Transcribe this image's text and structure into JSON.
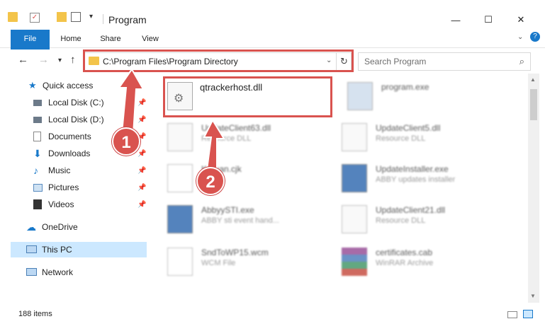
{
  "window": {
    "title": "Program",
    "minimize": "—",
    "maximize": "☐",
    "close": "✕"
  },
  "ribbon": {
    "tabs": [
      "File",
      "Home",
      "Share",
      "View"
    ]
  },
  "address": {
    "path": "C:\\Program Files\\Program Directory"
  },
  "search": {
    "placeholder": "Search Program"
  },
  "sidebar": {
    "items": [
      {
        "label": "Quick access"
      },
      {
        "label": "Local Disk (C:)"
      },
      {
        "label": "Local Disk (D:)"
      },
      {
        "label": "Documents"
      },
      {
        "label": "Downloads"
      },
      {
        "label": "Music"
      },
      {
        "label": "Pictures"
      },
      {
        "label": "Videos"
      },
      {
        "label": "OneDrive"
      },
      {
        "label": "This PC"
      },
      {
        "label": "Network"
      }
    ]
  },
  "files": [
    {
      "name": "qtrackerhost.dll",
      "desc": ""
    },
    {
      "name": "program.exe",
      "desc": ""
    },
    {
      "name": "UpdateClient63.dll",
      "desc": "Resource DLL"
    },
    {
      "name": "UpdateClient5.dll",
      "desc": "Resource DLL"
    },
    {
      "name": "Korean.cjk",
      "desc": ""
    },
    {
      "name": "UpdateInstaller.exe",
      "desc": "ABBY updates installer"
    },
    {
      "name": "AbbyySTI.exe",
      "desc": "ABBY sti event hand..."
    },
    {
      "name": "UpdateClient21.dll",
      "desc": "Resource DLL"
    },
    {
      "name": "SndToWP15.wcm",
      "desc": "WCM File"
    },
    {
      "name": "certificates.cab",
      "desc": "WinRAR Archive"
    }
  ],
  "status": {
    "count": "188 items"
  },
  "callouts": [
    "1",
    "2"
  ],
  "colors": {
    "accent": "#1979ca",
    "highlight": "#d9534f",
    "selected": "#cce8ff"
  }
}
